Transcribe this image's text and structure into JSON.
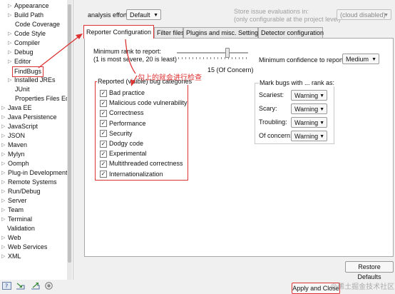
{
  "tree": {
    "items": [
      {
        "label": "Appearance",
        "expandable": true
      },
      {
        "label": "Build Path",
        "expandable": true
      },
      {
        "label": "Code Coverage",
        "expandable": false
      },
      {
        "label": "Code Style",
        "expandable": true
      },
      {
        "label": "Compiler",
        "expandable": true
      },
      {
        "label": "Debug",
        "expandable": true
      },
      {
        "label": "Editor",
        "expandable": true
      },
      {
        "label": "FindBugs",
        "expandable": false
      },
      {
        "label": "Installed JREs",
        "expandable": true
      },
      {
        "label": "JUnit",
        "expandable": false
      },
      {
        "label": "Properties Files Edi",
        "expandable": false
      },
      {
        "label": "Java EE",
        "expandable": true
      },
      {
        "label": "Java Persistence",
        "expandable": true
      },
      {
        "label": "JavaScript",
        "expandable": true
      },
      {
        "label": "JSON",
        "expandable": true
      },
      {
        "label": "Maven",
        "expandable": true
      },
      {
        "label": "Mylyn",
        "expandable": true
      },
      {
        "label": "Oomph",
        "expandable": true
      },
      {
        "label": "Plug-in Development",
        "expandable": true
      },
      {
        "label": "Remote Systems",
        "expandable": true
      },
      {
        "label": "Run/Debug",
        "expandable": true
      },
      {
        "label": "Server",
        "expandable": true
      },
      {
        "label": "Team",
        "expandable": true
      },
      {
        "label": "Terminal",
        "expandable": true
      },
      {
        "label": "Validation",
        "expandable": false
      },
      {
        "label": "Web",
        "expandable": true
      },
      {
        "label": "Web Services",
        "expandable": true
      },
      {
        "label": "XML",
        "expandable": true
      }
    ]
  },
  "analysis_effort": {
    "label": "analysis effort",
    "value": "Default"
  },
  "store": {
    "line1": "Store issue evaluations in:",
    "line2": "(only configurable at the project level)",
    "value": "(cloud disabled)"
  },
  "tabs": [
    {
      "label": "Reporter Configuration"
    },
    {
      "label": "Filter files"
    },
    {
      "label": "Plugins and misc. Settings"
    },
    {
      "label": "Detector configuration"
    }
  ],
  "min_rank": {
    "line1": "Minimum rank to report:",
    "line2": "(1 is most severe, 20 is least)",
    "value_text": "15 (Of Concern)",
    "value": 15,
    "min": 1,
    "max": 20
  },
  "min_confidence": {
    "label": "Minimum confidence to report:",
    "value": "Medium"
  },
  "categories": {
    "title": "Reported (visible) bug categories",
    "items": [
      {
        "label": "Bad practice",
        "checked": true
      },
      {
        "label": "Malicious code vulnerability",
        "checked": true
      },
      {
        "label": "Correctness",
        "checked": true
      },
      {
        "label": "Performance",
        "checked": true
      },
      {
        "label": "Security",
        "checked": true
      },
      {
        "label": "Dodgy code",
        "checked": true
      },
      {
        "label": "Experimental",
        "checked": true
      },
      {
        "label": "Multithreaded correctness",
        "checked": true
      },
      {
        "label": "Internationalization",
        "checked": true
      }
    ]
  },
  "mark_bugs": {
    "title": "Mark bugs with ... rank as:",
    "rows": [
      {
        "label": "Scariest:",
        "value": "Warning"
      },
      {
        "label": "Scary:",
        "value": "Warning"
      },
      {
        "label": "Troubling:",
        "value": "Warning"
      },
      {
        "label": "Of concern:",
        "value": "Warning"
      }
    ]
  },
  "annotation": "勾上的就会进行检查",
  "buttons": {
    "restore": "Restore Defaults",
    "apply_close": "Apply and Close"
  },
  "watermark": "@稀土掘金技术社区",
  "colors": {
    "highlight": "#dd3333",
    "annotation": "#e03030"
  }
}
